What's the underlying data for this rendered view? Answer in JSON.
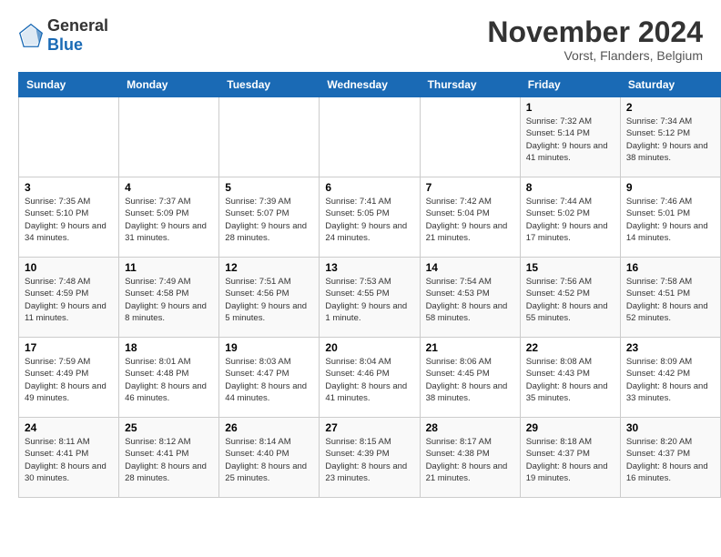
{
  "header": {
    "logo_general": "General",
    "logo_blue": "Blue",
    "month_title": "November 2024",
    "location": "Vorst, Flanders, Belgium"
  },
  "weekdays": [
    "Sunday",
    "Monday",
    "Tuesday",
    "Wednesday",
    "Thursday",
    "Friday",
    "Saturday"
  ],
  "weeks": [
    [
      {
        "day": "",
        "info": ""
      },
      {
        "day": "",
        "info": ""
      },
      {
        "day": "",
        "info": ""
      },
      {
        "day": "",
        "info": ""
      },
      {
        "day": "",
        "info": ""
      },
      {
        "day": "1",
        "info": "Sunrise: 7:32 AM\nSunset: 5:14 PM\nDaylight: 9 hours and 41 minutes."
      },
      {
        "day": "2",
        "info": "Sunrise: 7:34 AM\nSunset: 5:12 PM\nDaylight: 9 hours and 38 minutes."
      }
    ],
    [
      {
        "day": "3",
        "info": "Sunrise: 7:35 AM\nSunset: 5:10 PM\nDaylight: 9 hours and 34 minutes."
      },
      {
        "day": "4",
        "info": "Sunrise: 7:37 AM\nSunset: 5:09 PM\nDaylight: 9 hours and 31 minutes."
      },
      {
        "day": "5",
        "info": "Sunrise: 7:39 AM\nSunset: 5:07 PM\nDaylight: 9 hours and 28 minutes."
      },
      {
        "day": "6",
        "info": "Sunrise: 7:41 AM\nSunset: 5:05 PM\nDaylight: 9 hours and 24 minutes."
      },
      {
        "day": "7",
        "info": "Sunrise: 7:42 AM\nSunset: 5:04 PM\nDaylight: 9 hours and 21 minutes."
      },
      {
        "day": "8",
        "info": "Sunrise: 7:44 AM\nSunset: 5:02 PM\nDaylight: 9 hours and 17 minutes."
      },
      {
        "day": "9",
        "info": "Sunrise: 7:46 AM\nSunset: 5:01 PM\nDaylight: 9 hours and 14 minutes."
      }
    ],
    [
      {
        "day": "10",
        "info": "Sunrise: 7:48 AM\nSunset: 4:59 PM\nDaylight: 9 hours and 11 minutes."
      },
      {
        "day": "11",
        "info": "Sunrise: 7:49 AM\nSunset: 4:58 PM\nDaylight: 9 hours and 8 minutes."
      },
      {
        "day": "12",
        "info": "Sunrise: 7:51 AM\nSunset: 4:56 PM\nDaylight: 9 hours and 5 minutes."
      },
      {
        "day": "13",
        "info": "Sunrise: 7:53 AM\nSunset: 4:55 PM\nDaylight: 9 hours and 1 minute."
      },
      {
        "day": "14",
        "info": "Sunrise: 7:54 AM\nSunset: 4:53 PM\nDaylight: 8 hours and 58 minutes."
      },
      {
        "day": "15",
        "info": "Sunrise: 7:56 AM\nSunset: 4:52 PM\nDaylight: 8 hours and 55 minutes."
      },
      {
        "day": "16",
        "info": "Sunrise: 7:58 AM\nSunset: 4:51 PM\nDaylight: 8 hours and 52 minutes."
      }
    ],
    [
      {
        "day": "17",
        "info": "Sunrise: 7:59 AM\nSunset: 4:49 PM\nDaylight: 8 hours and 49 minutes."
      },
      {
        "day": "18",
        "info": "Sunrise: 8:01 AM\nSunset: 4:48 PM\nDaylight: 8 hours and 46 minutes."
      },
      {
        "day": "19",
        "info": "Sunrise: 8:03 AM\nSunset: 4:47 PM\nDaylight: 8 hours and 44 minutes."
      },
      {
        "day": "20",
        "info": "Sunrise: 8:04 AM\nSunset: 4:46 PM\nDaylight: 8 hours and 41 minutes."
      },
      {
        "day": "21",
        "info": "Sunrise: 8:06 AM\nSunset: 4:45 PM\nDaylight: 8 hours and 38 minutes."
      },
      {
        "day": "22",
        "info": "Sunrise: 8:08 AM\nSunset: 4:43 PM\nDaylight: 8 hours and 35 minutes."
      },
      {
        "day": "23",
        "info": "Sunrise: 8:09 AM\nSunset: 4:42 PM\nDaylight: 8 hours and 33 minutes."
      }
    ],
    [
      {
        "day": "24",
        "info": "Sunrise: 8:11 AM\nSunset: 4:41 PM\nDaylight: 8 hours and 30 minutes."
      },
      {
        "day": "25",
        "info": "Sunrise: 8:12 AM\nSunset: 4:41 PM\nDaylight: 8 hours and 28 minutes."
      },
      {
        "day": "26",
        "info": "Sunrise: 8:14 AM\nSunset: 4:40 PM\nDaylight: 8 hours and 25 minutes."
      },
      {
        "day": "27",
        "info": "Sunrise: 8:15 AM\nSunset: 4:39 PM\nDaylight: 8 hours and 23 minutes."
      },
      {
        "day": "28",
        "info": "Sunrise: 8:17 AM\nSunset: 4:38 PM\nDaylight: 8 hours and 21 minutes."
      },
      {
        "day": "29",
        "info": "Sunrise: 8:18 AM\nSunset: 4:37 PM\nDaylight: 8 hours and 19 minutes."
      },
      {
        "day": "30",
        "info": "Sunrise: 8:20 AM\nSunset: 4:37 PM\nDaylight: 8 hours and 16 minutes."
      }
    ]
  ]
}
